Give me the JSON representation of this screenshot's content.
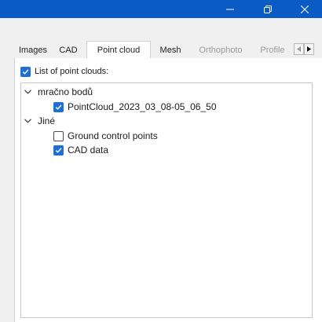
{
  "window": {
    "minimize_icon": "minimize-icon",
    "restore_icon": "restore-icon",
    "close_icon": "close-icon",
    "titlebar_color": "#0a5cc4"
  },
  "tabs": [
    {
      "label": "Images",
      "active": false,
      "enabled": true
    },
    {
      "label": "CAD",
      "active": false,
      "enabled": true
    },
    {
      "label": "Point cloud",
      "active": true,
      "enabled": true
    },
    {
      "label": "Mesh",
      "active": false,
      "enabled": true
    },
    {
      "label": "Orthophoto",
      "active": false,
      "enabled": false
    },
    {
      "label": "Profile",
      "active": false,
      "enabled": false
    }
  ],
  "list": {
    "label": "List of point clouds:",
    "checked": true
  },
  "tree": [
    {
      "label": "mračno bodů",
      "expanded": true,
      "children": [
        {
          "label": "PointCloud_2023_03_08-05_06_50",
          "checked": true
        }
      ]
    },
    {
      "label": "Jiné",
      "expanded": true,
      "children": [
        {
          "label": "Ground control points",
          "checked": false
        },
        {
          "label": "CAD data",
          "checked": true
        }
      ]
    }
  ],
  "colors": {
    "accent": "#1f6fd1",
    "disabled_text": "#9a9a9a"
  }
}
